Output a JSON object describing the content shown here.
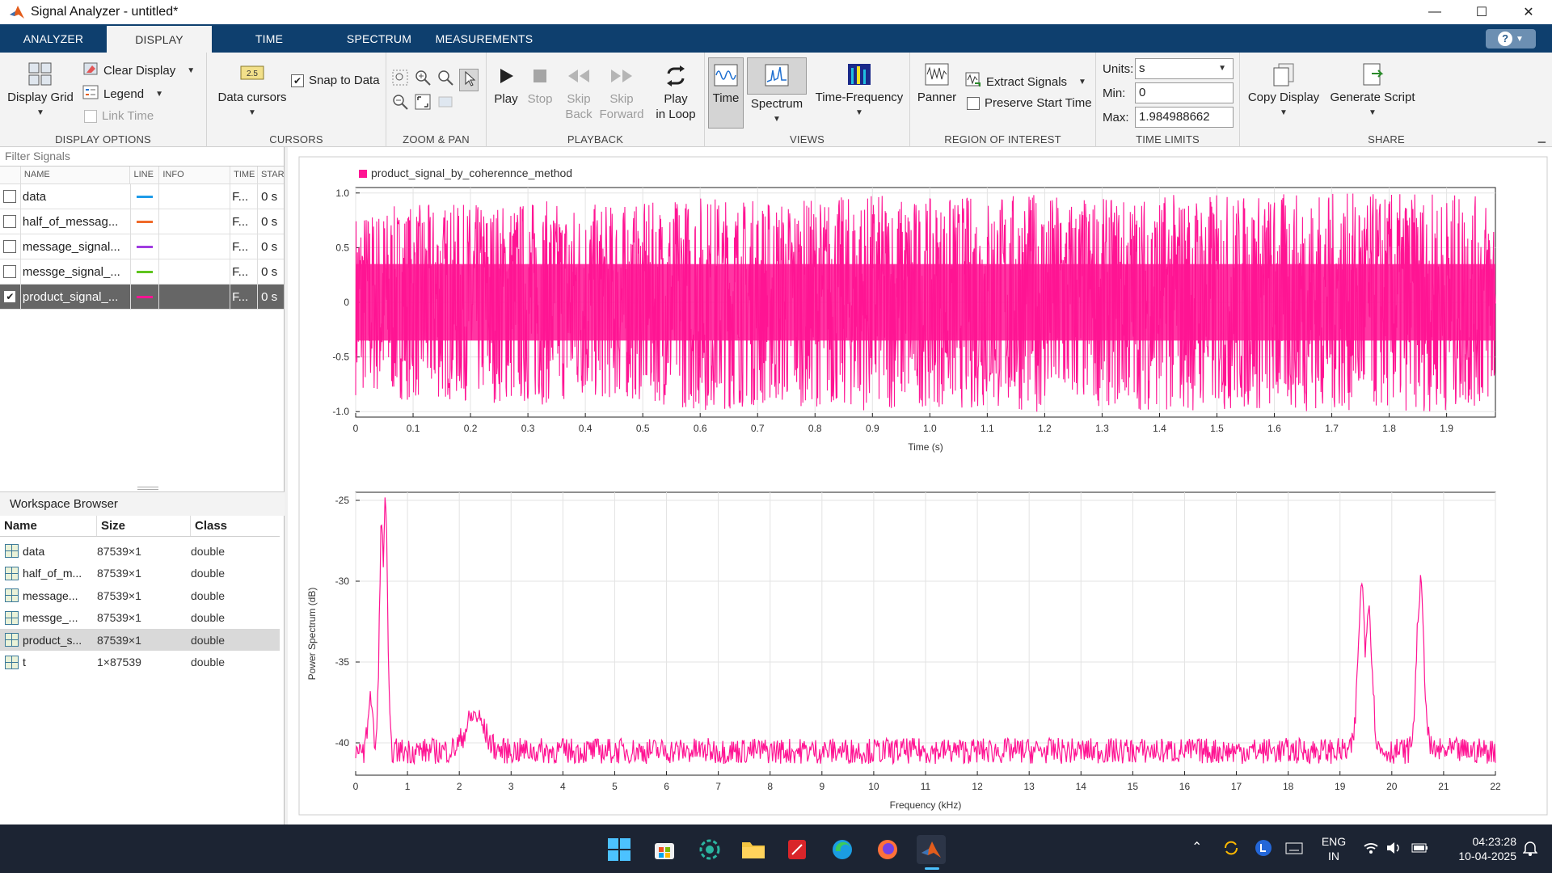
{
  "window": {
    "title": "Signal Analyzer - untitled*"
  },
  "tabs": [
    {
      "label": "ANALYZER"
    },
    {
      "label": "DISPLAY"
    },
    {
      "label": "TIME"
    },
    {
      "label": "SPECTRUM"
    },
    {
      "label": "MEASUREMENTS"
    }
  ],
  "help": {
    "label": "?"
  },
  "ribbon": {
    "display_options": {
      "label": "DISPLAY OPTIONS",
      "display_grid": "Display Grid",
      "clear_display": "Clear Display",
      "legend": "Legend",
      "link_time": "Link Time"
    },
    "cursors": {
      "label": "CURSORS",
      "data_cursors": "Data cursors",
      "snap_to_data": "Snap to Data",
      "cursor_icon_text": "2.5"
    },
    "zoom_pan": {
      "label": "ZOOM & PAN"
    },
    "playback": {
      "label": "PLAYBACK",
      "play": "Play",
      "stop": "Stop",
      "skip_back": [
        "Skip",
        "Back"
      ],
      "skip_forward": [
        "Skip",
        "Forward"
      ],
      "play_loop": [
        "Play",
        "in Loop"
      ]
    },
    "views": {
      "label": "VIEWS",
      "time": "Time",
      "spectrum": "Spectrum",
      "time_frequency": "Time-Frequency"
    },
    "roi": {
      "label": "REGION OF INTEREST",
      "panner": "Panner",
      "extract": "Extract Signals",
      "preserve": "Preserve Start Time"
    },
    "time_limits": {
      "label": "TIME LIMITS",
      "units_label": "Units:",
      "units_value": "s",
      "min_label": "Min:",
      "min_value": "0",
      "max_label": "Max:",
      "max_value": "1.984988662"
    },
    "share": {
      "label": "SHARE",
      "copy": "Copy Display",
      "script": "Generate Script"
    }
  },
  "signals": {
    "filter_placeholder": "Filter Signals",
    "headers": {
      "name": "NAME",
      "line": "LINE",
      "info": "INFO",
      "time": "TIME",
      "start": "STAR"
    },
    "rows": [
      {
        "name": "data",
        "color": "#1e9be8",
        "time": "F...",
        "start": "0 s",
        "checked": false
      },
      {
        "name": "half_of_messag...",
        "color": "#f06a2a",
        "time": "F...",
        "start": "0 s",
        "checked": false
      },
      {
        "name": "message_signal...",
        "color": "#a03ce0",
        "time": "F...",
        "start": "0 s",
        "checked": false
      },
      {
        "name": "messge_signal_...",
        "color": "#5fc41e",
        "time": "F...",
        "start": "0 s",
        "checked": false
      },
      {
        "name": "product_signal_...",
        "color": "#ff1493",
        "time": "F...",
        "start": "0 s",
        "checked": true
      }
    ]
  },
  "workspace": {
    "title": "Workspace Browser",
    "headers": {
      "name": "Name",
      "size": "Size",
      "class": "Class"
    },
    "rows": [
      {
        "name": "data",
        "size": "87539×1",
        "class": "double"
      },
      {
        "name": "half_of_m...",
        "size": "87539×1",
        "class": "double"
      },
      {
        "name": "message...",
        "size": "87539×1",
        "class": "double"
      },
      {
        "name": "messge_...",
        "size": "87539×1",
        "class": "double"
      },
      {
        "name": "product_s...",
        "size": "87539×1",
        "class": "double"
      },
      {
        "name": "t",
        "size": "1×87539",
        "class": "double"
      }
    ]
  },
  "chart_data": [
    {
      "type": "line",
      "legend": "product_signal_by_coherennce_method",
      "color": "#ff1493",
      "xlabel": "Time (s)",
      "ylabel": "",
      "xlim": [
        0,
        1.985
      ],
      "ylim": [
        -1.05,
        1.05
      ],
      "x_ticks": [
        "0",
        "0.1",
        "0.2",
        "0.3",
        "0.4",
        "0.5",
        "0.6",
        "0.7",
        "0.8",
        "0.9",
        "1.0",
        "1.1",
        "1.2",
        "1.3",
        "1.4",
        "1.5",
        "1.6",
        "1.7",
        "1.8",
        "1.9"
      ],
      "y_ticks": [
        "1.0",
        "0.5",
        "0",
        "-0.5",
        "-1.0"
      ],
      "envelope": {
        "x": [
          0,
          0.1,
          0.2,
          0.3,
          0.4,
          0.5,
          0.6,
          0.7,
          0.8,
          0.9,
          1.0,
          1.1,
          1.2,
          1.3,
          1.4,
          1.5,
          1.6,
          1.7,
          1.8,
          1.9,
          1.985
        ],
        "amplitude": [
          0.85,
          0.9,
          0.9,
          0.95,
          0.9,
          0.9,
          1.0,
          0.95,
          0.95,
          1.0,
          0.95,
          1.0,
          1.0,
          0.95,
          1.0,
          1.0,
          1.0,
          1.0,
          1.0,
          1.0,
          0.95
        ]
      },
      "grid": true
    },
    {
      "type": "line",
      "color": "#ff1493",
      "xlabel": "Frequency (kHz)",
      "ylabel": "Power Spectrum (dB)",
      "xlim": [
        0,
        22
      ],
      "ylim": [
        -42,
        -24.5
      ],
      "x_ticks": [
        "0",
        "1",
        "2",
        "3",
        "4",
        "5",
        "6",
        "7",
        "8",
        "9",
        "10",
        "11",
        "12",
        "13",
        "14",
        "15",
        "16",
        "17",
        "18",
        "19",
        "20",
        "21",
        "22"
      ],
      "y_ticks": [
        "-25",
        "-30",
        "-35",
        "-40"
      ],
      "peaks": [
        {
          "x": 0.28,
          "y": -37
        },
        {
          "x": 0.5,
          "y": -26.5
        },
        {
          "x": 0.57,
          "y": -24.7
        },
        {
          "x": 2.3,
          "y": -38.3
        },
        {
          "x": 19.42,
          "y": -30.4
        },
        {
          "x": 19.55,
          "y": -31.5
        },
        {
          "x": 20.55,
          "y": -30.4
        }
      ],
      "noise_floor": -40.5,
      "grid": true
    }
  ],
  "taskbar": {
    "lang": "ENG",
    "region": "IN",
    "time": "04:23:28",
    "date": "10-04-2025"
  }
}
